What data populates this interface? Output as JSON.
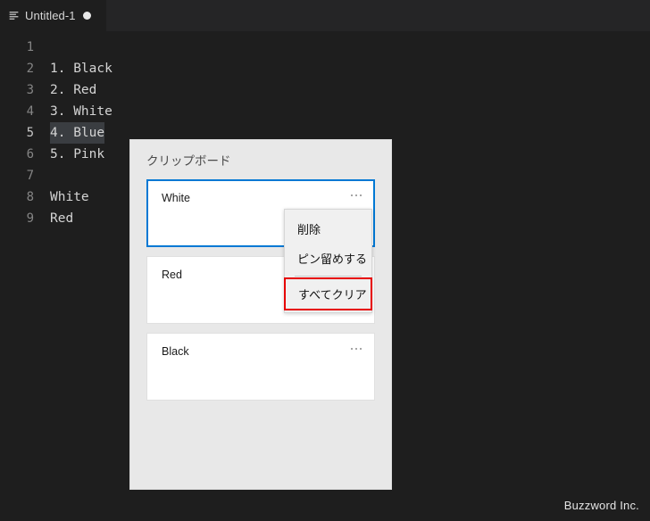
{
  "window": {
    "theme_bg": "#1e1e1e",
    "tabbar_bg": "#252526"
  },
  "tab": {
    "label": "Untitled-1",
    "icon": "lines-document-icon",
    "dirty_indicator": "unsaved-dot"
  },
  "editor": {
    "lines": [
      {
        "number": "1",
        "text": "",
        "active": false
      },
      {
        "number": "2",
        "text": "1. Black",
        "active": false
      },
      {
        "number": "3",
        "text": "2. Red",
        "active": false
      },
      {
        "number": "4",
        "text": "3. White",
        "active": false
      },
      {
        "number": "5",
        "text": "4. Blue",
        "active": true
      },
      {
        "number": "6",
        "text": "5. Pink",
        "active": false
      },
      {
        "number": "7",
        "text": "",
        "active": false
      },
      {
        "number": "8",
        "text": "White",
        "active": false
      },
      {
        "number": "9",
        "text": "Red",
        "active": false
      }
    ]
  },
  "clipboard_panel": {
    "title": "クリップボード",
    "accent_color": "#0078d4",
    "items": [
      {
        "text": "White",
        "selected": true,
        "more_icon": "ellipsis-icon"
      },
      {
        "text": "Red",
        "selected": false,
        "more_icon": "ellipsis-icon"
      },
      {
        "text": "Black",
        "selected": false,
        "more_icon": "ellipsis-icon"
      }
    ]
  },
  "context_menu": {
    "highlight_color": "#e60000",
    "items": [
      {
        "label": "削除",
        "type": "item",
        "highlighted": false
      },
      {
        "label": "ピン留めする",
        "type": "item",
        "highlighted": false
      },
      {
        "label": "",
        "type": "separator",
        "highlighted": false
      },
      {
        "label": "すべてクリア",
        "type": "item",
        "highlighted": true
      }
    ]
  },
  "watermark": {
    "text": "Buzzword Inc."
  }
}
